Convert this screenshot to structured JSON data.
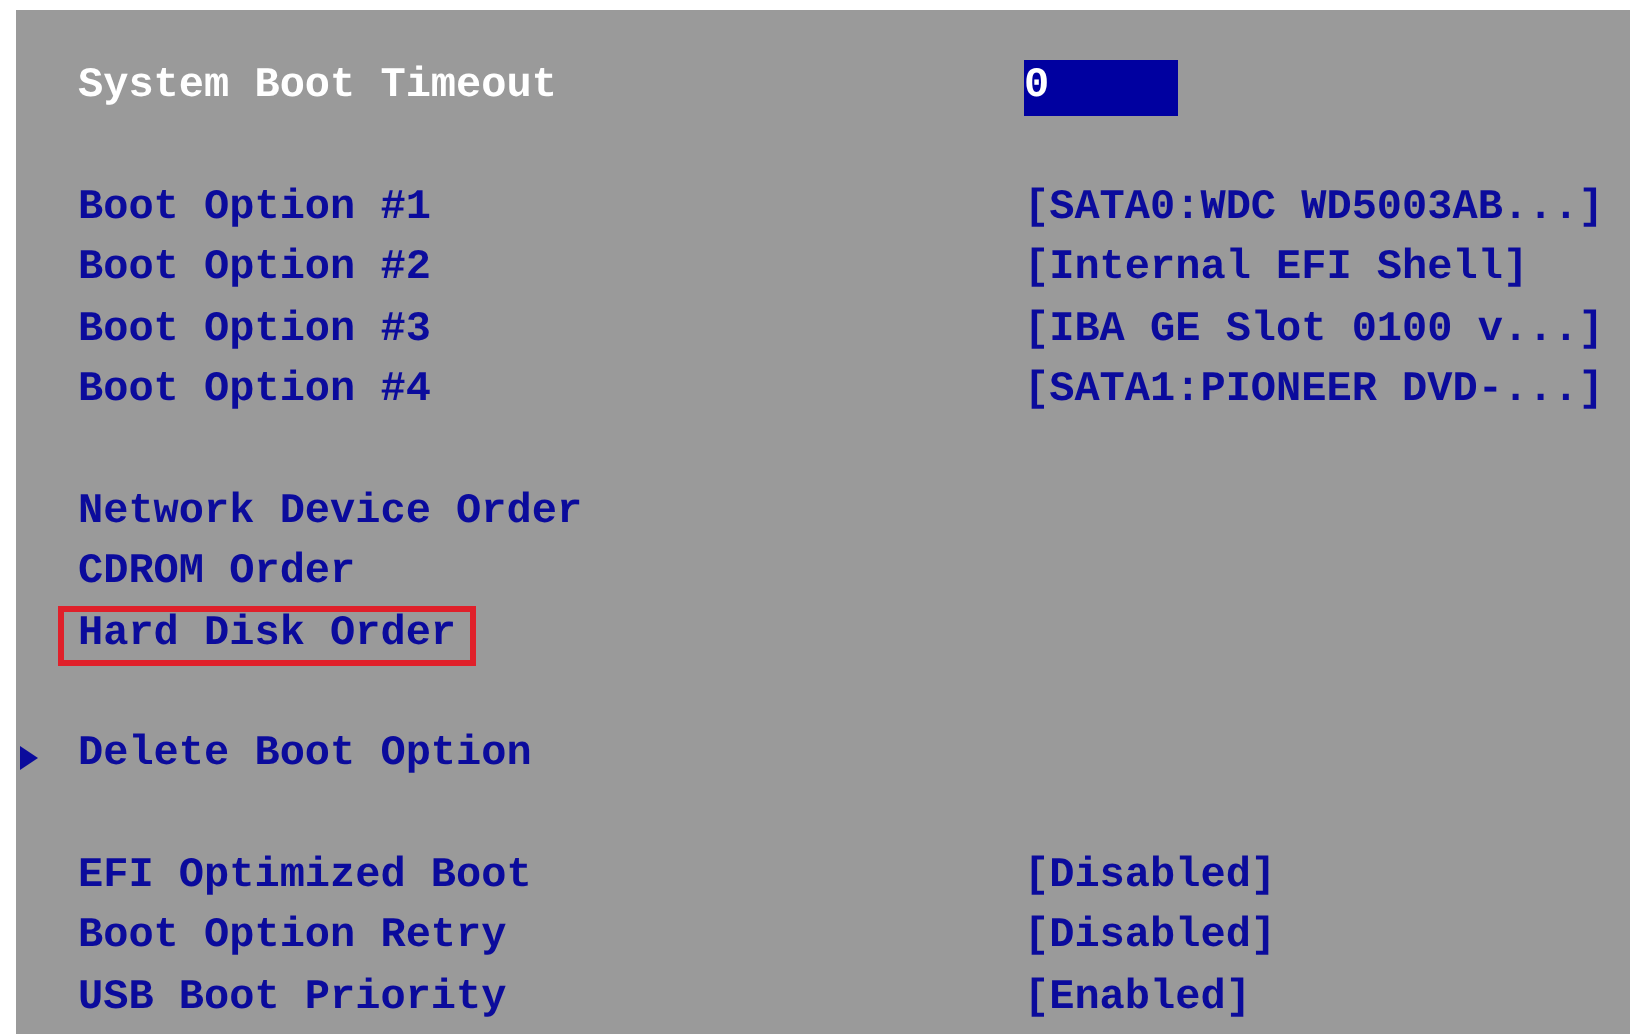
{
  "sections": [
    {
      "items": [
        {
          "label": "System Boot Timeout",
          "value": "0",
          "selected": true,
          "outlined": false,
          "submenu": false
        }
      ]
    },
    {
      "items": [
        {
          "label": "Boot Option #1",
          "value": "[SATA0:WDC WD5003AB...]",
          "selected": false,
          "outlined": false,
          "submenu": false
        },
        {
          "label": "Boot Option #2",
          "value": "[Internal EFI Shell]",
          "selected": false,
          "outlined": false,
          "submenu": false
        },
        {
          "label": "Boot Option #3",
          "value": "[IBA GE Slot 0100 v...]",
          "selected": false,
          "outlined": false,
          "submenu": false
        },
        {
          "label": "Boot Option #4",
          "value": "[SATA1:PIONEER DVD-...]",
          "selected": false,
          "outlined": false,
          "submenu": false
        }
      ]
    },
    {
      "items": [
        {
          "label": "Network Device Order",
          "selected": false,
          "outlined": false,
          "submenu": false
        },
        {
          "label": "CDROM Order",
          "selected": false,
          "outlined": false,
          "submenu": false
        },
        {
          "label": "Hard Disk Order",
          "selected": false,
          "outlined": true,
          "submenu": false
        }
      ]
    },
    {
      "items": [
        {
          "label": "Delete Boot Option",
          "selected": false,
          "outlined": false,
          "submenu": true
        }
      ]
    },
    {
      "items": [
        {
          "label": "EFI Optimized Boot",
          "value": "[Disabled]",
          "selected": false,
          "outlined": false,
          "submenu": false
        },
        {
          "label": "Boot Option Retry",
          "value": "[Disabled]",
          "selected": false,
          "outlined": false,
          "submenu": false
        },
        {
          "label": "USB Boot Priority",
          "value": "[Enabled]",
          "selected": false,
          "outlined": false,
          "submenu": false
        }
      ]
    }
  ]
}
